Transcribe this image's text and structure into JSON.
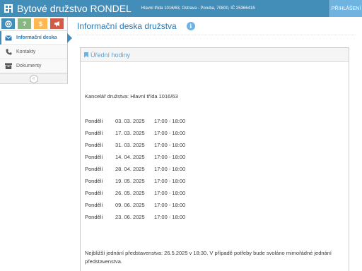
{
  "header": {
    "title": "Bytové družstvo RONDEL",
    "address": "Hlavní třída 1016/63, Ostrava - Poruba, 70800, IČ 25366416",
    "login_label": "PŘIHLÁŠENÍ"
  },
  "sidebar": {
    "shortcuts": [
      {
        "icon": "help-circle-icon",
        "color": "#438eb9"
      },
      {
        "icon": "question-icon",
        "glyph": "?",
        "color": "#87b87f"
      },
      {
        "icon": "dollar-icon",
        "glyph": "$",
        "color": "#ffb752"
      },
      {
        "icon": "megaphone-icon",
        "color": "#d15b47"
      }
    ],
    "items": [
      {
        "label": "Informační deska",
        "icon": "envelope-icon",
        "active": true
      },
      {
        "label": "Kontakty",
        "icon": "phone-icon",
        "active": false
      },
      {
        "label": "Dokumenty",
        "icon": "archive-icon",
        "active": false
      }
    ],
    "collapse_glyph": "«"
  },
  "page": {
    "title": "Informační deska družstva",
    "info_glyph": "i"
  },
  "widget": {
    "title": "Úřední hodiny",
    "office": "Kancelář družstva: Hlavní třída 1016/63",
    "hours": [
      {
        "day": "Pondělí",
        "date": "03. 03. 2025",
        "time": "17:00 - 18:00"
      },
      {
        "day": "Pondělí",
        "date": "17. 03. 2025",
        "time": "17:00 - 18:00"
      },
      {
        "day": "Pondělí",
        "date": "31. 03. 2025",
        "time": "17:00 - 18:00"
      },
      {
        "day": "Pondělí",
        "date": "14. 04. 2025",
        "time": "17:00 - 18:00"
      },
      {
        "day": "Pondělí",
        "date": "28. 04. 2025",
        "time": "17:00 - 18:00"
      },
      {
        "day": "Pondělí",
        "date": "19. 05. 2025",
        "time": "17:00 - 18:00"
      },
      {
        "day": "Pondělí",
        "date": "26. 05. 2025",
        "time": "17:00 - 18:00"
      },
      {
        "day": "Pondělí",
        "date": "09. 06. 2025",
        "time": "17:00 - 18:00"
      },
      {
        "day": "Pondělí",
        "date": "23. 06. 2025",
        "time": "17:00 - 18:00"
      }
    ],
    "note": "Nejbližší jednání představenstva: 26.5.2025 v 18:30. V případě potřeby bude svoláno mimořádné jednání představenstva."
  },
  "colors": {
    "header_bg": "#438eb9",
    "accent": "#2679b5",
    "login_bg": "#6fb3e0"
  }
}
